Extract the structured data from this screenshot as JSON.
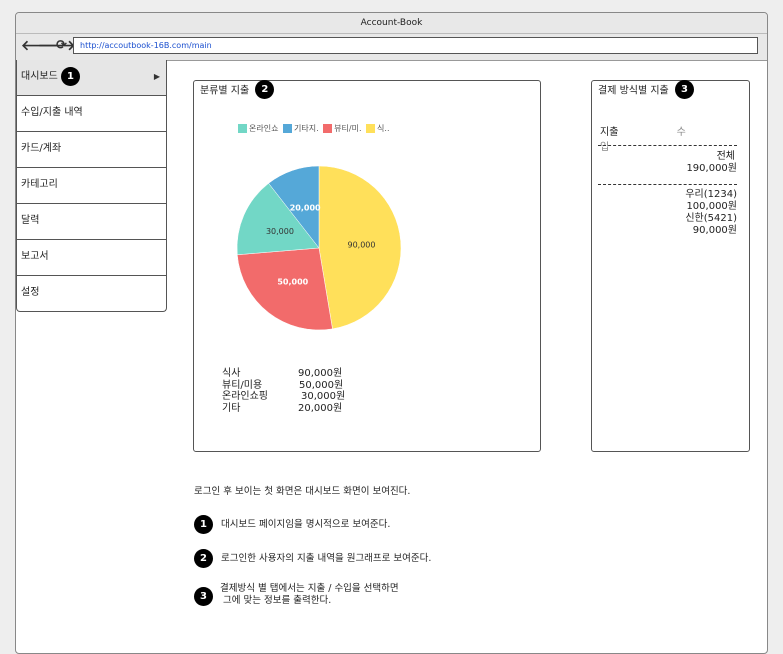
{
  "window": {
    "title": "Account-Book"
  },
  "browser": {
    "back_icon": "back-arrow-icon",
    "forward_icon": "forward-arrow-icon",
    "refresh_icon": "refresh-icon",
    "url": "http://accoutbook-16B.com/main"
  },
  "sidebar": {
    "items": [
      {
        "label": "대시보드",
        "badge": "1"
      },
      {
        "label": "수입/지출 내역"
      },
      {
        "label": "카드/계좌"
      },
      {
        "label": "카테고리"
      },
      {
        "label": "달력"
      },
      {
        "label": "보고서"
      },
      {
        "label": "설정"
      }
    ]
  },
  "category_panel": {
    "title": "분류별 지출",
    "badge": "2",
    "legend": [
      "온라인쇼",
      "기타지.",
      "뷰티/미.",
      "식.."
    ],
    "summary": [
      {
        "label": "식사",
        "amount": "90,000원"
      },
      {
        "label": "뷰티/미용",
        "amount": "50,000원"
      },
      {
        "label": "온라인쇼핑",
        "amount": "30,000원"
      },
      {
        "label": "기타",
        "amount": "20,000원"
      }
    ]
  },
  "payment_panel": {
    "title": "결제 방식별 지출",
    "badge": "3",
    "tab_expense": "지출",
    "tab_income": "수입",
    "total_label": "전체",
    "total_amount": "190,000원",
    "methods": [
      {
        "name": "우리(1234)",
        "amount": "100,000원"
      },
      {
        "name": "신한(5421)",
        "amount": "90,000원"
      }
    ]
  },
  "notes": {
    "intro": "로그인 후 보이는 첫 화면은 대시보드 화면이 보여진다.",
    "items": [
      {
        "badge": "1",
        "text": "대시보드 페이지임을 명시적으로 보여준다."
      },
      {
        "badge": "2",
        "text": "로그인한 사용자의 지출 내역을 원그래프로 보여준다."
      },
      {
        "badge": "3",
        "line1": "결제방식 별 탭에서는 지출 / 수입을 선택하면",
        "line2": "그에 맞는 정보를 출력한다."
      }
    ]
  },
  "chart_data": {
    "type": "pie",
    "categories": [
      "식사",
      "뷰티/미용",
      "온라인쇼핑",
      "기타"
    ],
    "values": [
      90000,
      50000,
      30000,
      20000
    ],
    "data_labels": [
      "90,000",
      "50,000",
      "30,000",
      "20,000"
    ],
    "colors": [
      "#ffe05a",
      "#f26b6b",
      "#72d7c6",
      "#55a8d8"
    ],
    "label_colors": [
      "#333333",
      "#ffffff",
      "#333333",
      "#ffffff"
    ]
  }
}
